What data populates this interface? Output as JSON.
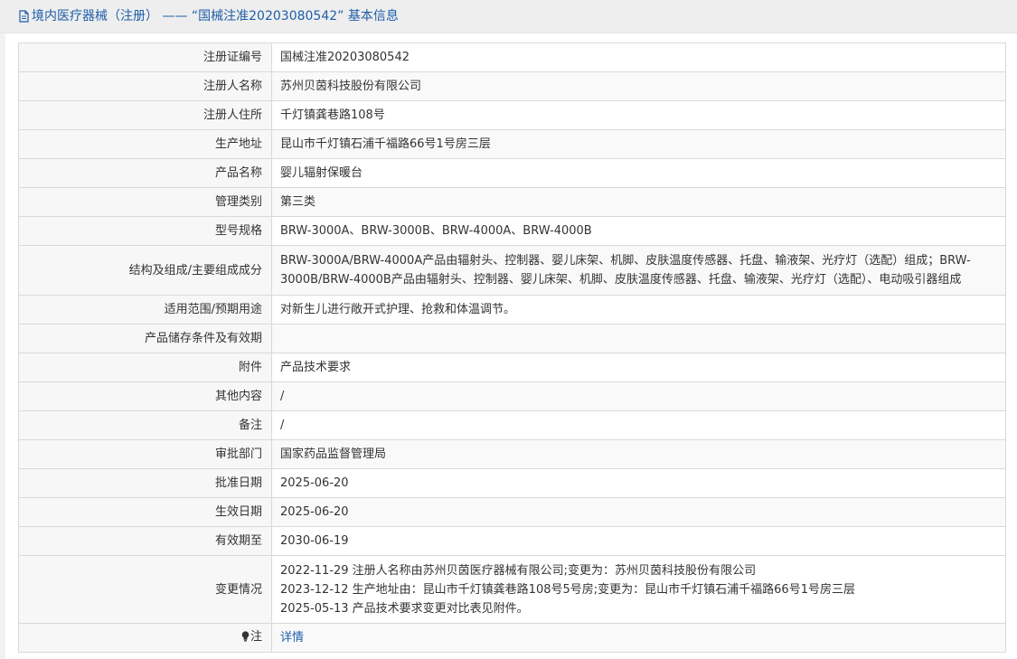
{
  "header": {
    "title": "境内医疗器械（注册） —— “国械注准20203080542” 基本信息"
  },
  "rows": [
    {
      "label": "注册证编号",
      "value": "国械注准20203080542"
    },
    {
      "label": "注册人名称",
      "value": "苏州贝茵科技股份有限公司"
    },
    {
      "label": "注册人住所",
      "value": "千灯镇龚巷路108号"
    },
    {
      "label": "生产地址",
      "value": "昆山市千灯镇石浦千福路66号1号房三层"
    },
    {
      "label": "产品名称",
      "value": "婴儿辐射保暖台"
    },
    {
      "label": "管理类别",
      "value": "第三类"
    },
    {
      "label": "型号规格",
      "value": "BRW-3000A、BRW-3000B、BRW-4000A、BRW-4000B"
    },
    {
      "label": "结构及组成/主要组成成分",
      "value": "BRW-3000A/BRW-4000A产品由辐射头、控制器、婴儿床架、机脚、皮肤温度传感器、托盘、输液架、光疗灯（选配）组成；BRW-3000B/BRW-4000B产品由辐射头、控制器、婴儿床架、机脚、皮肤温度传感器、托盘、输液架、光疗灯（选配）、电动吸引器组成"
    },
    {
      "label": "适用范围/预期用途",
      "value": "对新生儿进行敞开式护理、抢救和体温调节。"
    },
    {
      "label": "产品储存条件及有效期",
      "value": ""
    },
    {
      "label": "附件",
      "value": "产品技术要求"
    },
    {
      "label": "其他内容",
      "value": "/"
    },
    {
      "label": "备注",
      "value": "/"
    },
    {
      "label": "审批部门",
      "value": "国家药品监督管理局"
    },
    {
      "label": "批准日期",
      "value": "2025-06-20"
    },
    {
      "label": "生效日期",
      "value": "2025-06-20"
    },
    {
      "label": "有效期至",
      "value": "2030-06-19"
    }
  ],
  "changes": {
    "label": "变更情况",
    "lines": [
      "2022-11-29 注册人名称由苏州贝茵医疗器械有限公司;变更为：苏州贝茵科技股份有限公司",
      "2023-12-12 生产地址由：昆山市千灯镇龚巷路108号5号房;变更为：昆山市千灯镇石浦千福路66号1号房三层",
      "2025-05-13 产品技术要求变更对比表见附件。"
    ]
  },
  "note": {
    "label": "注",
    "link_text": "详情"
  },
  "icons": {
    "header": "document-icon",
    "note": "lightbulb-icon"
  },
  "colors": {
    "link": "#1e5ea8",
    "label_bg": "#f7f7f7",
    "border": "#d9d9d9"
  }
}
